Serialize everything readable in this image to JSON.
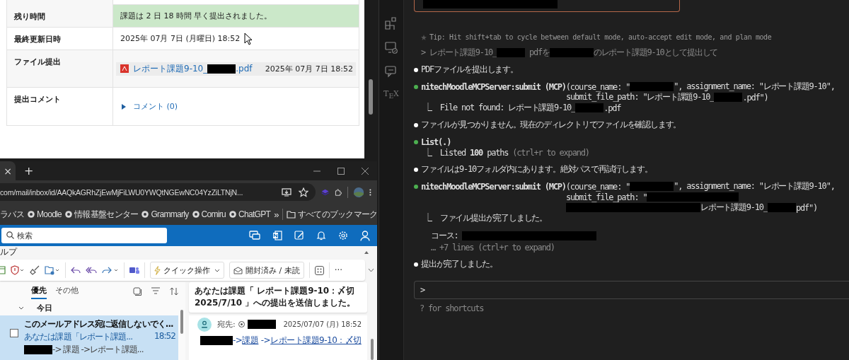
{
  "submission_table": {
    "rows": [
      {
        "label": "残り時間",
        "kind": "status",
        "text": "課題は 2 日 18 時間 早く提出されました。"
      },
      {
        "label": "最終更新日時",
        "kind": "date",
        "text": "2025年 07月 7日 (月曜日) 18:52"
      },
      {
        "label": "ファイル提出",
        "kind": "file",
        "file": [
          {
            "kind": "link",
            "text": "レポート課題9-10_"
          },
          {
            "kind": "mask"
          },
          {
            "kind": "link",
            "text": ".pdf"
          }
        ],
        "date": "2025年 07月 7日 18:52"
      },
      {
        "label": "提出コメント",
        "kind": "comments",
        "text": "コメント (0)",
        "expanded": false
      }
    ]
  },
  "browser": {
    "tab_close": "×",
    "new_tab": "+",
    "url": "com/mail/inbox/id/AAQkAGRhZjEwMjFiLWU0YWQtNGEwNC04YzZiLTNjN...",
    "bookmarks": [
      {
        "label": "ラバス",
        "icon": false
      },
      {
        "label": "Moodle",
        "icon": true
      },
      {
        "label": "情報基盤センター",
        "icon": true
      },
      {
        "label": "Grammarly",
        "icon": true
      },
      {
        "label": "Comiru",
        "icon": true
      },
      {
        "label": "ChatGPT",
        "icon": true
      }
    ],
    "more": "»",
    "all_bookmarks": "すべてのブックマーク"
  },
  "outlook": {
    "search": {
      "placeholder": "検索"
    },
    "ribbon_tab": "ルプ",
    "toolbar": {
      "quick_action": "クイック操作",
      "read_unread": "開封済み / 未読",
      "more": "···"
    },
    "list": {
      "tabs": [
        {
          "label": "優先",
          "selected": true
        },
        {
          "label": "その他",
          "selected": false
        }
      ],
      "group": {
        "label": "今日",
        "expanded": true
      },
      "messages": [
        {
          "sender": "このメールアドレス宛に返信しないでく...",
          "subject": "あなたは課題「レポート課題...",
          "time": "18:52",
          "preview": [
            {
              "kind": "mask"
            },
            {
              "kind": "text",
              "text": "-> 課題 ->レポート課題..."
            }
          ],
          "selected": true,
          "checked": false
        }
      ]
    },
    "reading": {
      "subject": "あなたは課題「 レポート課題9-10：〆切 2025/7/10 」への提出を送信しました。",
      "to_label": "宛先:",
      "date": "2025/07/07 (月) 18:52",
      "body": [
        {
          "kind": "mask"
        },
        {
          "kind": "text",
          "text": "->"
        },
        {
          "kind": "link",
          "text": "課題"
        },
        {
          "kind": "text",
          "text": " ->"
        },
        {
          "kind": "link",
          "text": "レポート課題9-10：〆切"
        }
      ]
    }
  },
  "terminal": {
    "activity_tex": "T$_{E}$X",
    "tip": "Tip: Hit shift+tab to cycle between default mode, auto-accept edit mode, and plan mode",
    "entries": [
      {
        "kind": "user",
        "lines": [
          {
            "kind": "head",
            "parts": [
              {
                "kind": "dim",
                "text": "> レポート課題9-10_"
              },
              {
                "kind": "mask"
              },
              {
                "kind": "dim",
                "text": " pdfを"
              },
              {
                "kind": "midmask"
              },
              {
                "kind": "dim",
                "text": "のレポート課題9-10として提出して"
              }
            ]
          }
        ]
      },
      {
        "kind": "message",
        "lines": [
          {
            "kind": "head",
            "parts": [
              {
                "kind": "text",
                "text": "PDFファイルを提出します。"
              }
            ]
          }
        ]
      },
      {
        "kind": "tool",
        "lines": [
          {
            "kind": "head",
            "parts": [
              {
                "kind": "bold",
                "text": "nitechMoodleMCPServer:submit (MCP)"
              },
              {
                "kind": "text",
                "text": "(course_name: \""
              },
              {
                "kind": "midmask"
              },
              {
                "kind": "text",
                "text": "\", assignment_name: \"レポート課題9-10\","
              }
            ]
          },
          {
            "kind": "wrap",
            "parts": [
              {
                "kind": "text",
                "text": "submit_file_path: \"レポート課題9-10_"
              },
              {
                "kind": "mask"
              },
              {
                "kind": "text",
                "text": ".pdf\")"
              }
            ]
          },
          {
            "kind": "result",
            "parts": [
              {
                "kind": "text",
                "text": "⎿  File not found: レポート課題9-10_"
              },
              {
                "kind": "mask"
              },
              {
                "kind": "text",
                "text": ".pdf"
              }
            ]
          }
        ]
      },
      {
        "kind": "message",
        "lines": [
          {
            "kind": "head",
            "parts": [
              {
                "kind": "text",
                "text": "ファイルが見つかりません。現在のディレクトリでファイルを確認します。"
              }
            ]
          }
        ]
      },
      {
        "kind": "tool",
        "lines": [
          {
            "kind": "head",
            "parts": [
              {
                "kind": "bold",
                "text": "List(.)"
              }
            ]
          },
          {
            "kind": "result",
            "parts": [
              {
                "kind": "text",
                "text": "⎿  Listed "
              },
              {
                "kind": "bold",
                "text": "100"
              },
              {
                "kind": "text",
                "text": " paths"
              },
              {
                "kind": "dim",
                "text": " (ctrl+r to expand)"
              }
            ]
          }
        ]
      },
      {
        "kind": "message",
        "lines": [
          {
            "kind": "head",
            "parts": [
              {
                "kind": "text",
                "text": "ファイルは9-10フォルダ内にあります。絶対パスで再試行します。"
              }
            ]
          }
        ]
      },
      {
        "kind": "tool",
        "lines": [
          {
            "kind": "head",
            "parts": [
              {
                "kind": "bold",
                "text": "nitechMoodleMCPServer:submit (MCP)"
              },
              {
                "kind": "text",
                "text": "(course_name: \""
              },
              {
                "kind": "midmask"
              },
              {
                "kind": "text",
                "text": "\", assignment_name: \"レポート課題9-10\","
              }
            ]
          },
          {
            "kind": "wrap",
            "parts": [
              {
                "kind": "text",
                "text": "submit_file_path: \""
              },
              {
                "kind": "widemask"
              }
            ]
          },
          {
            "kind": "wrap",
            "parts": [
              {
                "kind": "longmask"
              },
              {
                "kind": "text",
                "text": "レポート課題9-10_"
              },
              {
                "kind": "mask"
              },
              {
                "kind": "text",
                "text": "pdf\")"
              }
            ]
          },
          {
            "kind": "result",
            "parts": [
              {
                "kind": "text",
                "text": "⎿  ファイル提出が完了しました。"
              }
            ]
          },
          {
            "kind": "detail",
            "parts": [
              {
                "kind": "text",
                "text": "コース: "
              },
              {
                "kind": "longmask"
              }
            ]
          },
          {
            "kind": "note",
            "parts": [
              {
                "kind": "dim",
                "text": "… +7 lines (ctrl+r to expand)"
              }
            ]
          }
        ]
      },
      {
        "kind": "message",
        "lines": [
          {
            "kind": "head",
            "parts": [
              {
                "kind": "text",
                "text": "提出が完了しました。"
              }
            ]
          }
        ]
      }
    ],
    "prompt": ">",
    "hint": "? for shortcuts"
  }
}
